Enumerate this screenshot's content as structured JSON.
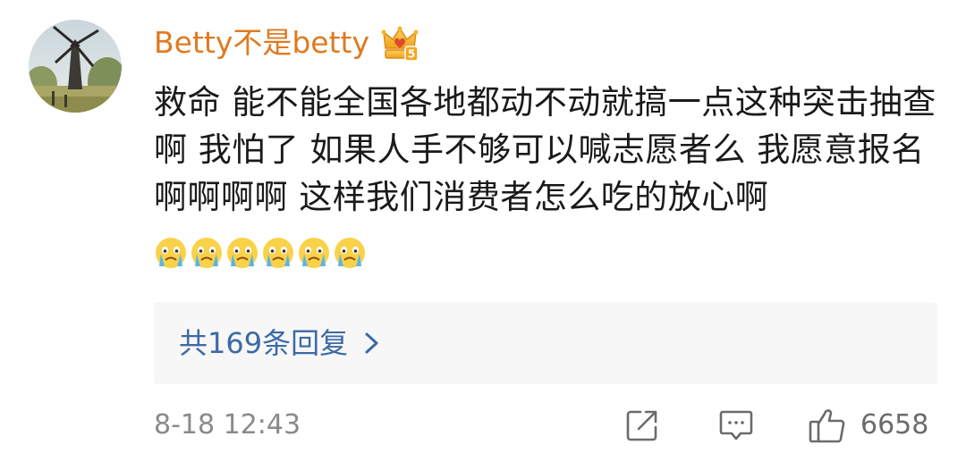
{
  "user": {
    "name": "Betty不是betty",
    "avatar_icon": "windmill-landscape-avatar",
    "badge_icon": "vip-crown-badge",
    "badge_color": "#f5a623"
  },
  "comment": {
    "text": "救命 能不能全国各地都动不动就搞一点这种突击抽查啊 我怕了 如果人手不够可以喊志愿者么 我愿意报名啊啊啊啊 这样我们消费者怎么吃的放心啊",
    "emoji_icon": "crying-face-emoji",
    "emoji_count": 6
  },
  "replies": {
    "label": "共169条回复",
    "icon": "chevron-right-icon"
  },
  "footer": {
    "timestamp": "8-18 12:43",
    "share_icon": "share-icon",
    "reply_icon": "comment-icon",
    "like_icon": "thumbs-up-icon",
    "like_count": "6658"
  },
  "colors": {
    "username": "#e07a1f",
    "link": "#3b6aa6",
    "meta": "#8a8a8a",
    "text": "#1a1a1a"
  }
}
